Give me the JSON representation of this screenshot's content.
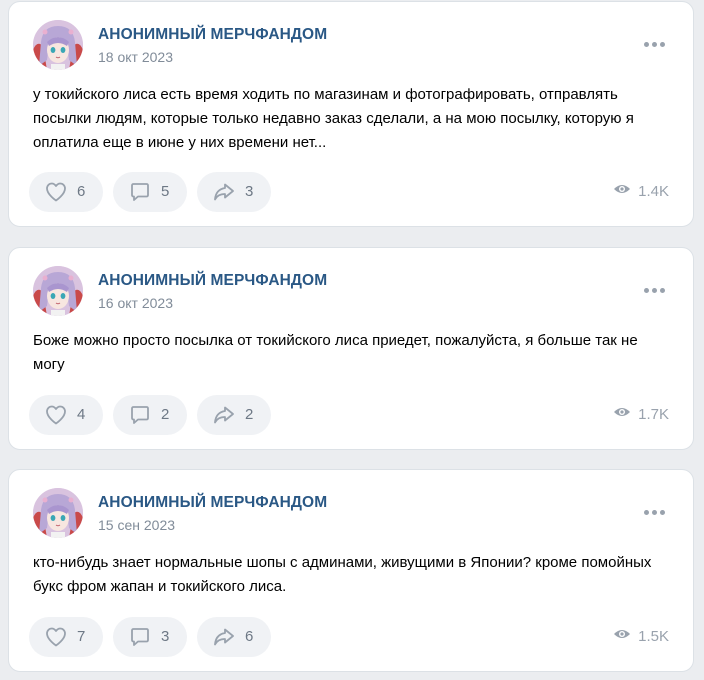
{
  "colors": {
    "author": "#2a5885",
    "date": "#818c99",
    "action_bg": "#f0f2f5",
    "icon": "#99a2ad",
    "page_bg": "#ebedf0"
  },
  "posts": [
    {
      "author": "АНОНИМНЫЙ МЕРЧФАНДОМ",
      "date": "18 окт 2023",
      "text": "у токийского лиса есть время ходить по магазинам и фотографировать, отправлять посылки людям, которые только недавно заказ сделали, а на мою посылку, которую я оплатила еще в июне у них времени нет...",
      "likes": "6",
      "comments": "5",
      "shares": "3",
      "views": "1.4K"
    },
    {
      "author": "АНОНИМНЫЙ МЕРЧФАНДОМ",
      "date": "16 окт 2023",
      "text": "Боже можно просто посылка от токийского лиса приедет, пожалуйста, я больше так не могу",
      "likes": "4",
      "comments": "2",
      "shares": "2",
      "views": "1.7K"
    },
    {
      "author": "АНОНИМНЫЙ МЕРЧФАНДОМ",
      "date": "15 сен 2023",
      "text": "кто-нибудь знает нормальные шопы с админами, живущими в Японии? кроме помойных букс фром жапан и токийского лиса.",
      "likes": "7",
      "comments": "3",
      "shares": "6",
      "views": "1.5K"
    }
  ],
  "icons": {
    "avatar": "anime-avatar-icon",
    "more": "more-dots-icon",
    "like": "heart-icon",
    "comment": "comment-icon",
    "share": "share-arrow-icon",
    "views": "eye-icon"
  }
}
